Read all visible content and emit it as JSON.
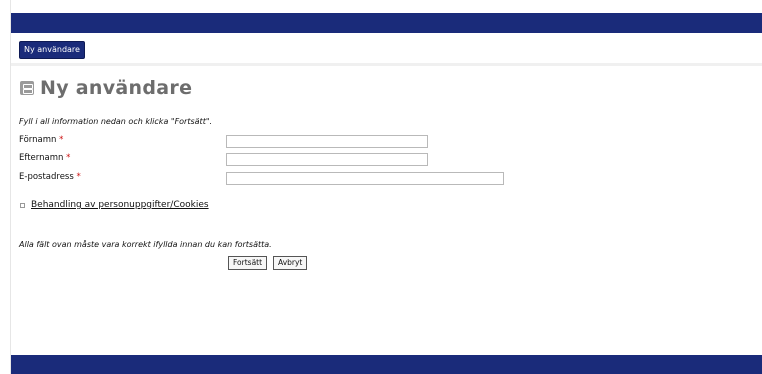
{
  "breadcrumb": {
    "label": "Ny användare"
  },
  "page": {
    "title": "Ny användare",
    "intro": "Fyll i all information nedan och klicka \"Fortsätt\".",
    "note": "Alla fält ovan måste vara korrekt ifyllda innan du kan fortsätta."
  },
  "form": {
    "firstname_label": "Förnamn",
    "lastname_label": "Efternamn",
    "email_label": "E-postadress",
    "required_marker": "*",
    "firstname_value": "",
    "lastname_value": "",
    "email_value": ""
  },
  "links": {
    "privacy": "Behandling av personuppgifter/Cookies"
  },
  "buttons": {
    "continue": "Fortsätt",
    "cancel": "Avbryt"
  },
  "colors": {
    "brand_bar": "#1a2b7a",
    "required": "#cc1111",
    "title": "#6d6d6d"
  },
  "icons": {
    "title": "user-card-icon",
    "privacy_bullet": "square-bullet-icon"
  }
}
